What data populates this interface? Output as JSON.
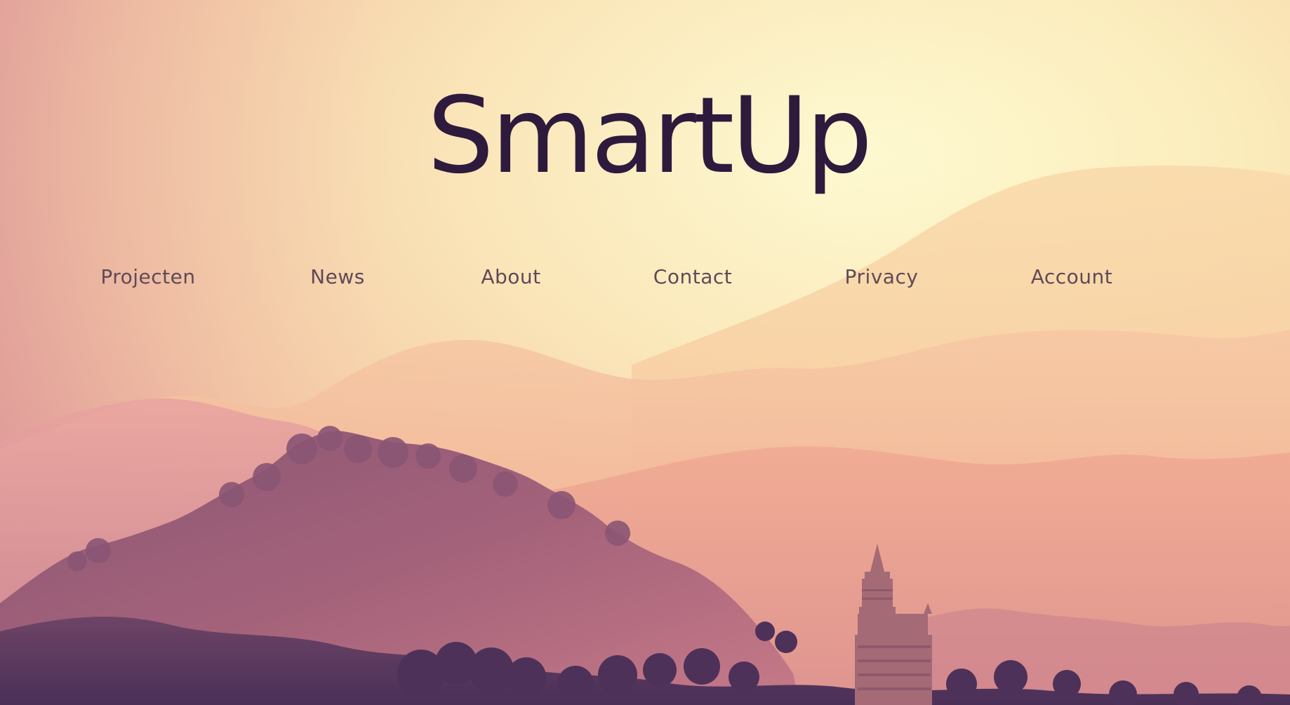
{
  "site": {
    "title": "SmartUp"
  },
  "nav": {
    "items": [
      {
        "label": "Projecten"
      },
      {
        "label": "News"
      },
      {
        "label": "About"
      },
      {
        "label": "Contact"
      },
      {
        "label": "Privacy"
      },
      {
        "label": "Account"
      }
    ]
  },
  "colors": {
    "title": "#2e1a3d",
    "nav_text": "#5f4a57",
    "sky_light": "#fdf5c7",
    "sky_warm": "#f7c6a0",
    "hills_far": "#f3b08e",
    "hills_mid": "#e9978d",
    "forest_dark": "#5c3b62"
  }
}
